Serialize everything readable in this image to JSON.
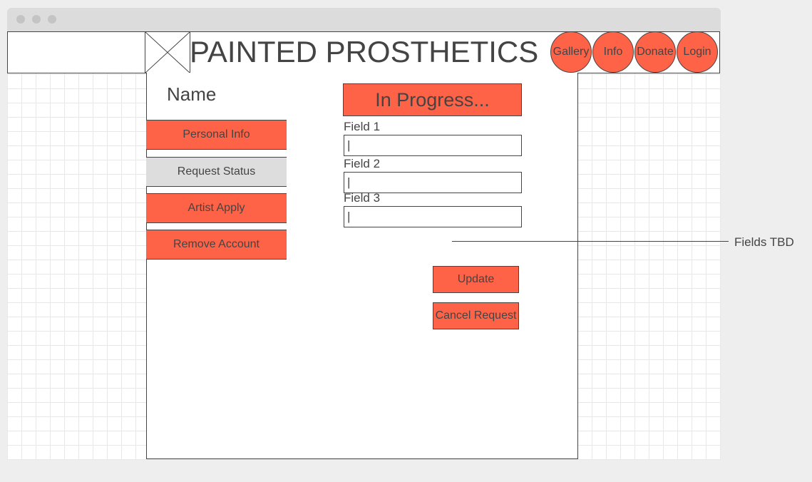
{
  "header": {
    "title": "PAINTED PROSTHETICS",
    "nav": [
      "Gallery",
      "Info",
      "Donate",
      "Login"
    ]
  },
  "sidebar": {
    "name": "Name",
    "items": [
      {
        "label": "Personal Info",
        "active": false
      },
      {
        "label": "Request Status",
        "active": true
      },
      {
        "label": "Artist Apply",
        "active": false
      },
      {
        "label": "Remove Account",
        "active": false
      }
    ]
  },
  "main": {
    "status": "In Progress...",
    "fields": [
      {
        "label": "Field 1",
        "value": "|"
      },
      {
        "label": "Field 2",
        "value": "|"
      },
      {
        "label": "Field 3",
        "value": "|"
      }
    ],
    "buttons": {
      "update": "Update",
      "cancel": "Cancel Request"
    }
  },
  "annotation": "Fields TBD",
  "colors": {
    "accent": "#ff6347",
    "active": "#dddddd",
    "stroke": "#444444"
  }
}
